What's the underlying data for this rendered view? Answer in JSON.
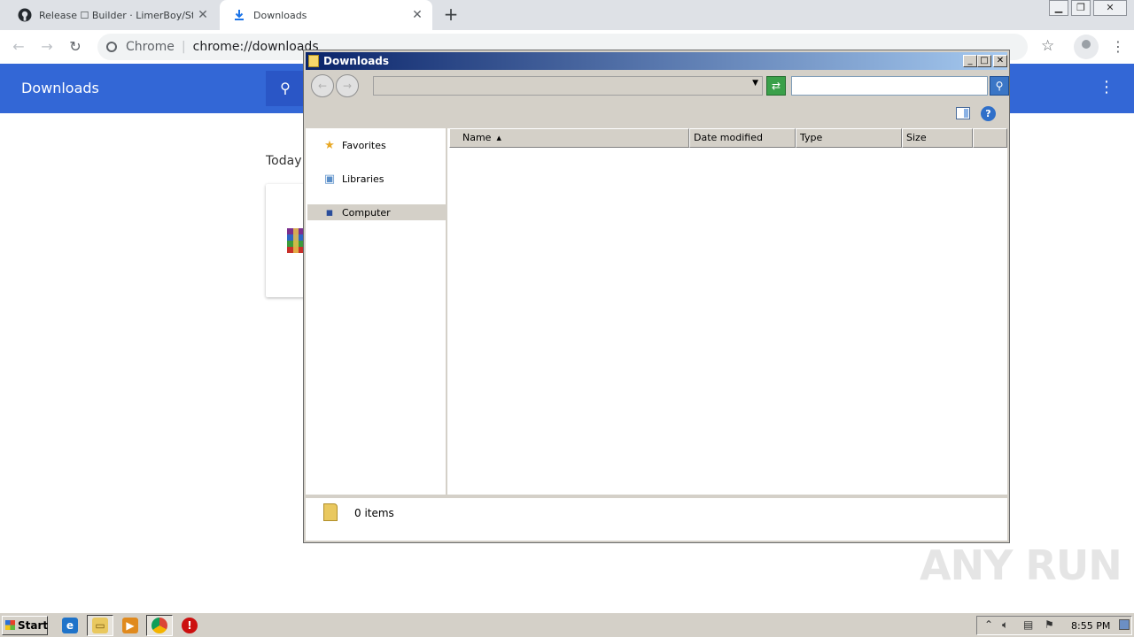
{
  "browser": {
    "tabs": [
      {
        "title": "Release ☐ Builder · LimerBoy/StormK",
        "icon": "github-icon"
      },
      {
        "title": "Downloads",
        "icon": "download-icon"
      }
    ],
    "address": {
      "scheme_label": "Chrome",
      "url": "chrome://downloads"
    }
  },
  "downloads_page": {
    "title": "Downloads",
    "section_label": "Today"
  },
  "explorer": {
    "title": "Downloads",
    "address_value": "",
    "search_placeholder": "",
    "nav_items": [
      {
        "label": "Favorites",
        "icon": "star-icon",
        "selected": false
      },
      {
        "label": "Libraries",
        "icon": "libraries-icon",
        "selected": false
      },
      {
        "label": "Computer",
        "icon": "computer-icon",
        "selected": true
      }
    ],
    "columns": [
      "Name",
      "Date modified",
      "Type",
      "Size"
    ],
    "sort_column": "Name",
    "items": [],
    "status": "0 items"
  },
  "watermark": "ANY RUN",
  "taskbar": {
    "start_label": "Start",
    "clock": "8:55 PM"
  },
  "colors": {
    "chrome_header": "#3367d6",
    "titlebar_start": "#0a246a",
    "titlebar_end": "#a6caf0",
    "classic_gray": "#d4d0c8"
  }
}
